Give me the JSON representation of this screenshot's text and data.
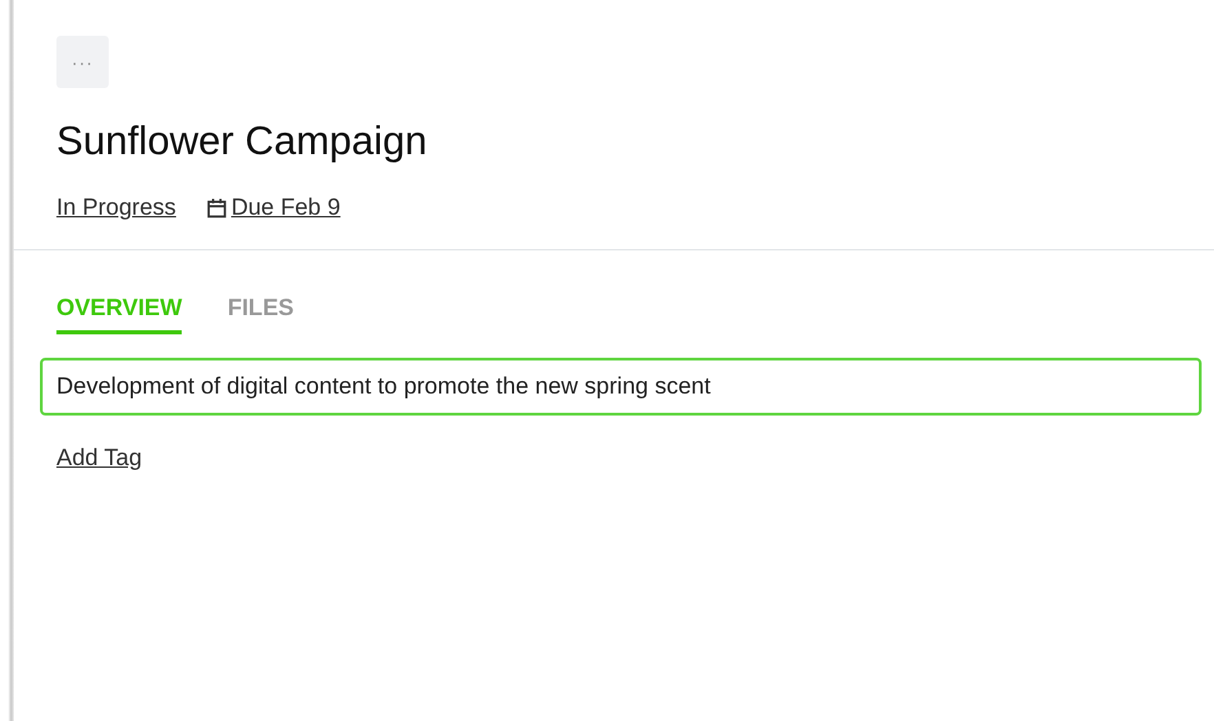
{
  "more_button": {
    "label": "···"
  },
  "title": "Sunflower Campaign",
  "meta": {
    "status": "In Progress",
    "due": "Due Feb 9"
  },
  "tabs": [
    {
      "label": "OVERVIEW",
      "selected": true
    },
    {
      "label": "FILES",
      "selected": false
    }
  ],
  "description": {
    "value": "Development of digital content to promote the new spring scent",
    "focused": true
  },
  "add_tag": "Add Tag"
}
